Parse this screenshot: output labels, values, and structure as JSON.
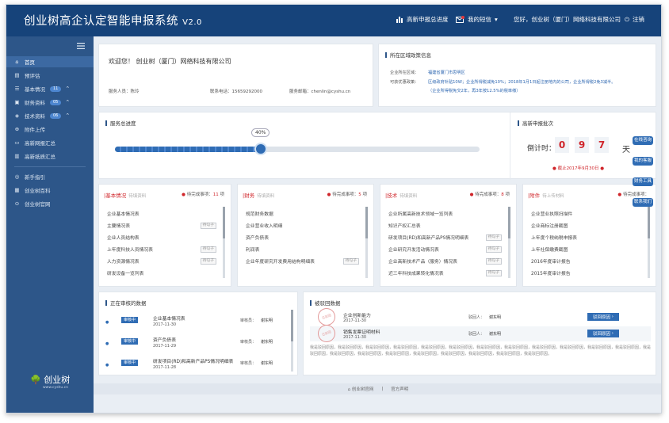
{
  "header": {
    "title": "创业树高企认定智能申报系统",
    "version": "V2.0",
    "batch_label": "高新申报总进度",
    "messages_label": "我的短信",
    "greeting": "您好，创业树（厦门）网络科技有限公司",
    "logout_label": "注销"
  },
  "sidebar": {
    "items": [
      {
        "label": "首页"
      },
      {
        "label": "预评估"
      },
      {
        "label": "基本情况",
        "badge": "11"
      },
      {
        "label": "财务资料",
        "badge": "05"
      },
      {
        "label": "技术资料",
        "badge": "06"
      },
      {
        "label": "附件上传"
      },
      {
        "label": "高新网报汇总"
      },
      {
        "label": "高新纸质汇总"
      },
      {
        "label": "新手指引"
      },
      {
        "label": "创业树百科"
      },
      {
        "label": "创业树官网"
      }
    ],
    "logo_text": "创业树",
    "logo_url": "www.cyshu.cn"
  },
  "welcome": {
    "text": "欢迎您！ 创业树（厦门）网络科技有限公司",
    "service_label": "服务人员：陈玲",
    "phone_label": "联系电话：15659292000",
    "email_label": "服务邮箱：chenlin@cyshu.cn"
  },
  "policy": {
    "title": "所在区域政策信息",
    "region_key": "企业所在区域：",
    "region_val": "福建省厦门市思明区",
    "policy_key": "可获优惠政策：",
    "policy_val1": "区级政府补贴10W；企业所得税减免10%；2018年1月1日起注册地内的公司，企业所得税2免3减半。",
    "policy_val2": "（企业所得税免交2年，再3年按12.5%的税率缴）"
  },
  "progress": {
    "title": "服务总进度",
    "percent_label": "40%",
    "value": 0.4
  },
  "countdown": {
    "title": "高新申报批次",
    "label": "倒计时：",
    "digits": [
      "0",
      "9",
      "7"
    ],
    "unit": "天",
    "deadline": "截止2017年9月30日"
  },
  "panels": [
    {
      "name": "基本情况",
      "sub": "待填资料",
      "todo_label": "待完成事项：",
      "todo": "11",
      "todo_suffix": "项",
      "items": [
        {
          "t": "企业基本情况表",
          "btn": ""
        },
        {
          "t": "主要情况表",
          "btn": "待勾子"
        },
        {
          "t": "企业人员结构表",
          "btn": ""
        },
        {
          "t": "上年度科技人员情况表",
          "btn": "待勾子"
        },
        {
          "t": "人力资源情况表",
          "btn": "待勾子"
        },
        {
          "t": "研发设备一览列表",
          "btn": ""
        }
      ]
    },
    {
      "name": "财务",
      "sub": "待填资料",
      "todo_label": "待完成事项：",
      "todo": "5",
      "todo_suffix": "项",
      "items": [
        {
          "t": "规范财务数据",
          "btn": ""
        },
        {
          "t": "企业营业收入明细",
          "btn": ""
        },
        {
          "t": "资产负债表",
          "btn": ""
        },
        {
          "t": "利润表",
          "btn": ""
        },
        {
          "t": "企业年度研究开发费用结构明细表",
          "btn": "待勾子"
        }
      ]
    },
    {
      "name": "技术",
      "sub": "待填资料",
      "todo_label": "待完成事项：",
      "todo": "8",
      "todo_suffix": "项",
      "items": [
        {
          "t": "企业所属高新技术领域一览列表",
          "btn": ""
        },
        {
          "t": "知识产权汇总表",
          "btn": ""
        },
        {
          "t": "研发项目(RD)和高新产品PS情况明细表",
          "btn": "待勾子"
        },
        {
          "t": "企业研究开发活动情况表",
          "btn": "待勾子"
        },
        {
          "t": "企业高新技术产品（服务）情况表",
          "btn": "待勾子"
        },
        {
          "t": "近三年科技成果转化情况表",
          "btn": "待勾子"
        }
      ]
    },
    {
      "name": "附件",
      "sub": "待上传材料",
      "todo_label": "待完成事项：",
      "todo": "",
      "todo_suffix": "",
      "items": [
        {
          "t": "企业营业执照扫描件",
          "btn": ""
        },
        {
          "t": "企业商标注册截图",
          "btn": ""
        },
        {
          "t": "上年度个税纳税申报表",
          "btn": ""
        },
        {
          "t": "上年社保缴费截图",
          "btn": ""
        },
        {
          "t": "2016年度审计报告",
          "btn": ""
        },
        {
          "t": "2015年度审计报告",
          "btn": ""
        }
      ]
    }
  ],
  "reviewing": {
    "title": "正在审核的数据",
    "status": "审核中",
    "reviewer": "审核员：",
    "reviewer_name": "谢东明",
    "items": [
      {
        "t": "企业基本情况表",
        "d": "2017-11-30"
      },
      {
        "t": "资产负债表",
        "d": "2017-11-29"
      },
      {
        "t": "研发项目(RD)和高新产品PS情况明细表",
        "d": "2017-11-28"
      }
    ]
  },
  "returned": {
    "title": "被驳回数据",
    "reviewer": "驳回人：",
    "reviewer_name": "谢东明",
    "btn": "驳回原因",
    "stamp": "已驳回",
    "items": [
      {
        "t": "企业创新能力",
        "d": "2017-11-30"
      },
      {
        "t": "销售发票证明材料",
        "d": "2017-11-30"
      }
    ],
    "reason": "我是驳回原因，我是驳回原因，我是驳回原因，我是驳回原因，我是驳回原因，我是驳回原因，我是驳回原因，我是驳回原因，我是驳回原因，我是驳回原因，我是驳回原因，我是驳回原因，我是驳回原因，我是驳回原因，我是驳回原因，我是驳回原因，我是驳回原因，我是驳回原因，我是驳回原因，我是驳回原因，我是驳回原因。"
  },
  "fabs": [
    {
      "t": "在线咨询"
    },
    {
      "t": "我的客服"
    },
    {
      "t": "财务工具"
    },
    {
      "t": "联系我们"
    }
  ],
  "footer": {
    "link1": "创业树官网",
    "link2": "官方声明"
  }
}
